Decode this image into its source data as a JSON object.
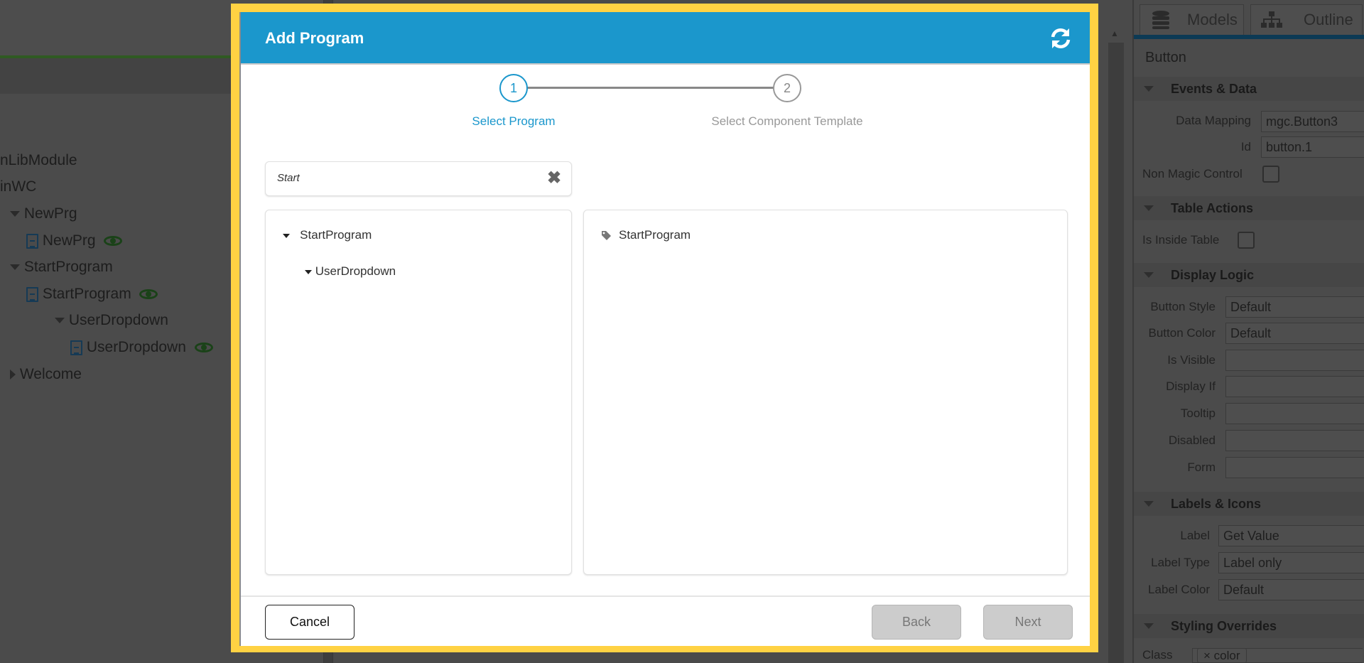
{
  "background_tree": {
    "items": [
      {
        "label": "nLibModule"
      },
      {
        "label": "inWC"
      },
      {
        "label": "NewPrg"
      },
      {
        "label": "NewPrg"
      },
      {
        "label": "StartProgram"
      },
      {
        "label": "StartProgram"
      },
      {
        "label": "UserDropdown"
      },
      {
        "label": "UserDropdown"
      },
      {
        "label": "Welcome"
      }
    ]
  },
  "properties_panel": {
    "tabs": [
      {
        "label": "Models",
        "icon": "database-icon"
      },
      {
        "label": "Outline",
        "icon": "sitemap-icon"
      }
    ],
    "component": "Button",
    "sections": {
      "events": {
        "title": "Events & Data",
        "data_mapping_label": "Data Mapping",
        "data_mapping_value": "mgc.Button3",
        "id_label": "Id",
        "id_value": "button.1",
        "non_magic_label": "Non Magic Control"
      },
      "table": {
        "title": "Table Actions",
        "inside_table_label": "Is Inside Table"
      },
      "display": {
        "title": "Display Logic",
        "button_style_label": "Button Style",
        "button_style_value": "Default",
        "button_color_label": "Button Color",
        "button_color_value": "Default",
        "is_visible_label": "Is Visible",
        "display_if_label": "Display If",
        "tooltip_label": "Tooltip",
        "disabled_label": "Disabled",
        "form_label": "Form"
      },
      "labels": {
        "title": "Labels & Icons",
        "label_label": "Label",
        "label_value": "Get Value",
        "label_type_label": "Label Type",
        "label_type_value": "Label only",
        "label_color_label": "Label Color",
        "label_color_value": "Default"
      },
      "styling": {
        "title": "Styling Overrides",
        "class_label": "Class",
        "class_chip": "× color"
      }
    }
  },
  "dialog": {
    "title": "Add Program",
    "refresh_icon": "refresh-icon",
    "steps": [
      {
        "number": "1",
        "label": "Select Program",
        "active": true
      },
      {
        "number": "2",
        "label": "Select Component Template",
        "active": false
      }
    ],
    "search": {
      "value": "Start"
    },
    "program_tree": [
      {
        "label": "StartProgram"
      },
      {
        "label": "UserDropdown"
      }
    ],
    "results": [
      {
        "label": "StartProgram",
        "icon": "tag-icon"
      }
    ],
    "buttons": {
      "cancel": "Cancel",
      "back": "Back",
      "next": "Next"
    },
    "colors": {
      "header": "#1b97cc",
      "highlight_frame": "#ffd243",
      "active_step": "#1b97cc"
    }
  }
}
